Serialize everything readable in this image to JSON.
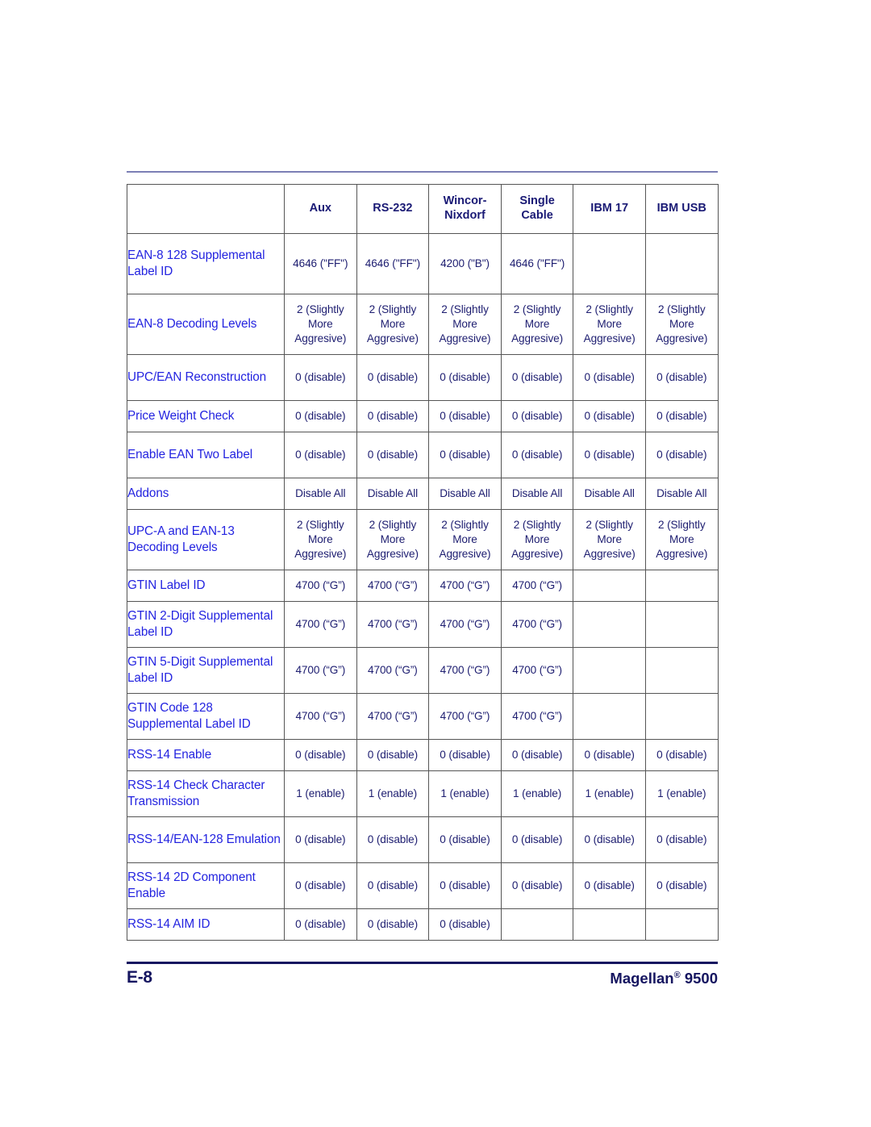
{
  "page": {
    "number_label": "E-8",
    "product_brand": "Magellan",
    "product_reg": "®",
    "product_model": "9500"
  },
  "table": {
    "columns": [
      "",
      "Aux",
      "RS-232",
      "Wincor-Nixdorf",
      "Single Cable",
      "IBM 17",
      "IBM USB"
    ],
    "column_headers": [
      {
        "line1": "Aux",
        "line2": ""
      },
      {
        "line1": "RS-232",
        "line2": ""
      },
      {
        "line1": "Wincor-",
        "line2": "Nixdorf"
      },
      {
        "line1": "Single",
        "line2": "Cable"
      },
      {
        "line1": "IBM 17",
        "line2": ""
      },
      {
        "line1": "IBM USB",
        "line2": ""
      }
    ],
    "rows": [
      {
        "label": "EAN-8 128 Supplemental Label ID",
        "height": "h3",
        "values": [
          "4646 (\"FF\")",
          "4646 (\"FF\")",
          "4200 (\"B\")",
          "4646 (\"FF\")",
          "",
          ""
        ]
      },
      {
        "label": "EAN-8 Decoding Levels",
        "height": "h3",
        "values": [
          "2 (Slightly More Aggresive)",
          "2 (Slightly More Aggresive)",
          "2 (Slightly More Aggresive)",
          "2 (Slightly More Aggresive)",
          "2 (Slightly More Aggresive)",
          "2 (Slightly More Aggresive)"
        ]
      },
      {
        "label": "UPC/EAN Reconstruction",
        "height": "h2",
        "values": [
          "0 (disable)",
          "0 (disable)",
          "0 (disable)",
          "0 (disable)",
          "0 (disable)",
          "0 (disable)"
        ]
      },
      {
        "label": "Price Weight Check",
        "height": "h1",
        "values": [
          "0 (disable)",
          "0 (disable)",
          "0 (disable)",
          "0 (disable)",
          "0 (disable)",
          "0 (disable)"
        ]
      },
      {
        "label": "Enable EAN Two Label",
        "height": "h2",
        "values": [
          "0 (disable)",
          "0 (disable)",
          "0 (disable)",
          "0 (disable)",
          "0 (disable)",
          "0 (disable)"
        ]
      },
      {
        "label": "Addons",
        "height": "h1",
        "values": [
          "Disable All",
          "Disable All",
          "Disable All",
          "Disable All",
          "Disable All",
          "Disable All"
        ]
      },
      {
        "label": "UPC-A and EAN-13 Decoding Levels",
        "height": "h3",
        "values": [
          "2 (Slightly More Aggresive)",
          "2 (Slightly More Aggresive)",
          "2 (Slightly More Aggresive)",
          "2 (Slightly More Aggresive)",
          "2 (Slightly More Aggresive)",
          "2 (Slightly More Aggresive)"
        ]
      },
      {
        "label": "GTIN Label ID",
        "height": "h1",
        "values": [
          "4700 (“G”)",
          "4700 (“G”)",
          "4700 (“G”)",
          "4700 (“G”)",
          "",
          ""
        ]
      },
      {
        "label": "GTIN 2-Digit Supplemental Label ID",
        "height": "h2",
        "values": [
          "4700 (“G”)",
          "4700 (“G”)",
          "4700 (“G”)",
          "4700 (“G”)",
          "",
          ""
        ]
      },
      {
        "label": "GTIN 5-Digit Supplemental Label ID",
        "height": "h2",
        "values": [
          "4700 (“G”)",
          "4700 (“G”)",
          "4700 (“G”)",
          "4700 (“G”)",
          "",
          ""
        ]
      },
      {
        "label": "GTIN Code 128 Supplemental Label ID",
        "height": "h2",
        "values": [
          "4700 (“G”)",
          "4700 (“G”)",
          "4700 (“G”)",
          "4700 (“G”)",
          "",
          ""
        ]
      },
      {
        "label": "RSS-14 Enable",
        "height": "h1",
        "values": [
          "0 (disable)",
          "0 (disable)",
          "0 (disable)",
          "0 (disable)",
          "0 (disable)",
          "0 (disable)"
        ]
      },
      {
        "label": "RSS-14 Check Character Transmission",
        "height": "h2",
        "values": [
          "1 (enable)",
          "1 (enable)",
          "1 (enable)",
          "1 (enable)",
          "1 (enable)",
          "1 (enable)"
        ]
      },
      {
        "label": "RSS-14/EAN-128 Emulation",
        "height": "h2",
        "values": [
          "0 (disable)",
          "0 (disable)",
          "0 (disable)",
          "0 (disable)",
          "0 (disable)",
          "0 (disable)"
        ]
      },
      {
        "label": "RSS-14 2D Component Enable",
        "height": "h2",
        "values": [
          "0 (disable)",
          "0 (disable)",
          "0 (disable)",
          "0 (disable)",
          "0 (disable)",
          "0 (disable)"
        ]
      },
      {
        "label": "RSS-14 AIM ID",
        "height": "h1",
        "values": [
          "0 (disable)",
          "0 (disable)",
          "0 (disable)",
          "",
          "",
          ""
        ]
      }
    ]
  },
  "colors": {
    "row_label": "#2323e0",
    "cell_value": "#1d1d70",
    "header_text": "#1a1a75",
    "footer_text": "#151560",
    "top_rule": "#7b7fb5",
    "table_border": "#555555"
  }
}
